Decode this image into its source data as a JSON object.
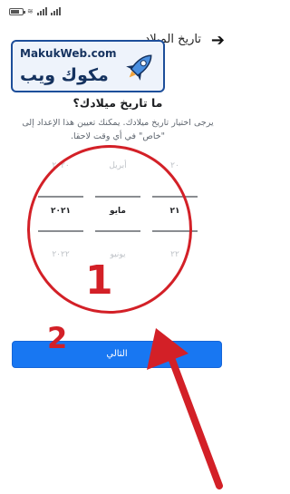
{
  "header": {
    "title": "تاريخ الميلاد",
    "back_icon": "arrow-right-icon"
  },
  "watermark": {
    "url": "MakukWeb.com",
    "brand": "مكوك ويب",
    "icon": "rocket-icon",
    "color": "#15325f"
  },
  "question": "ما تاريخ ميلادك؟",
  "description": "يرجى اختيار تاريخ ميلادك. يمكنك تعيين هذا الإعداد إلى \"خاص\" في أي وقت لاحقا.",
  "date_picker": {
    "columns": [
      {
        "name": "year",
        "values": [
          "٢٠٢٠",
          "٢٠٢١",
          "٢٠٢٢"
        ]
      },
      {
        "name": "month",
        "values": [
          "أبريل",
          "مايو",
          "يونيو"
        ]
      },
      {
        "name": "day",
        "values": [
          "٢٠",
          "٢١",
          "٢٢"
        ]
      }
    ],
    "selected": {
      "year": "٢٠٢١",
      "month": "مايو",
      "day": "٢١"
    }
  },
  "annotations": {
    "step1": "1",
    "step2": "2",
    "color": "#d32027"
  },
  "next_button": {
    "label": "التالي",
    "color": "#1877f2"
  }
}
